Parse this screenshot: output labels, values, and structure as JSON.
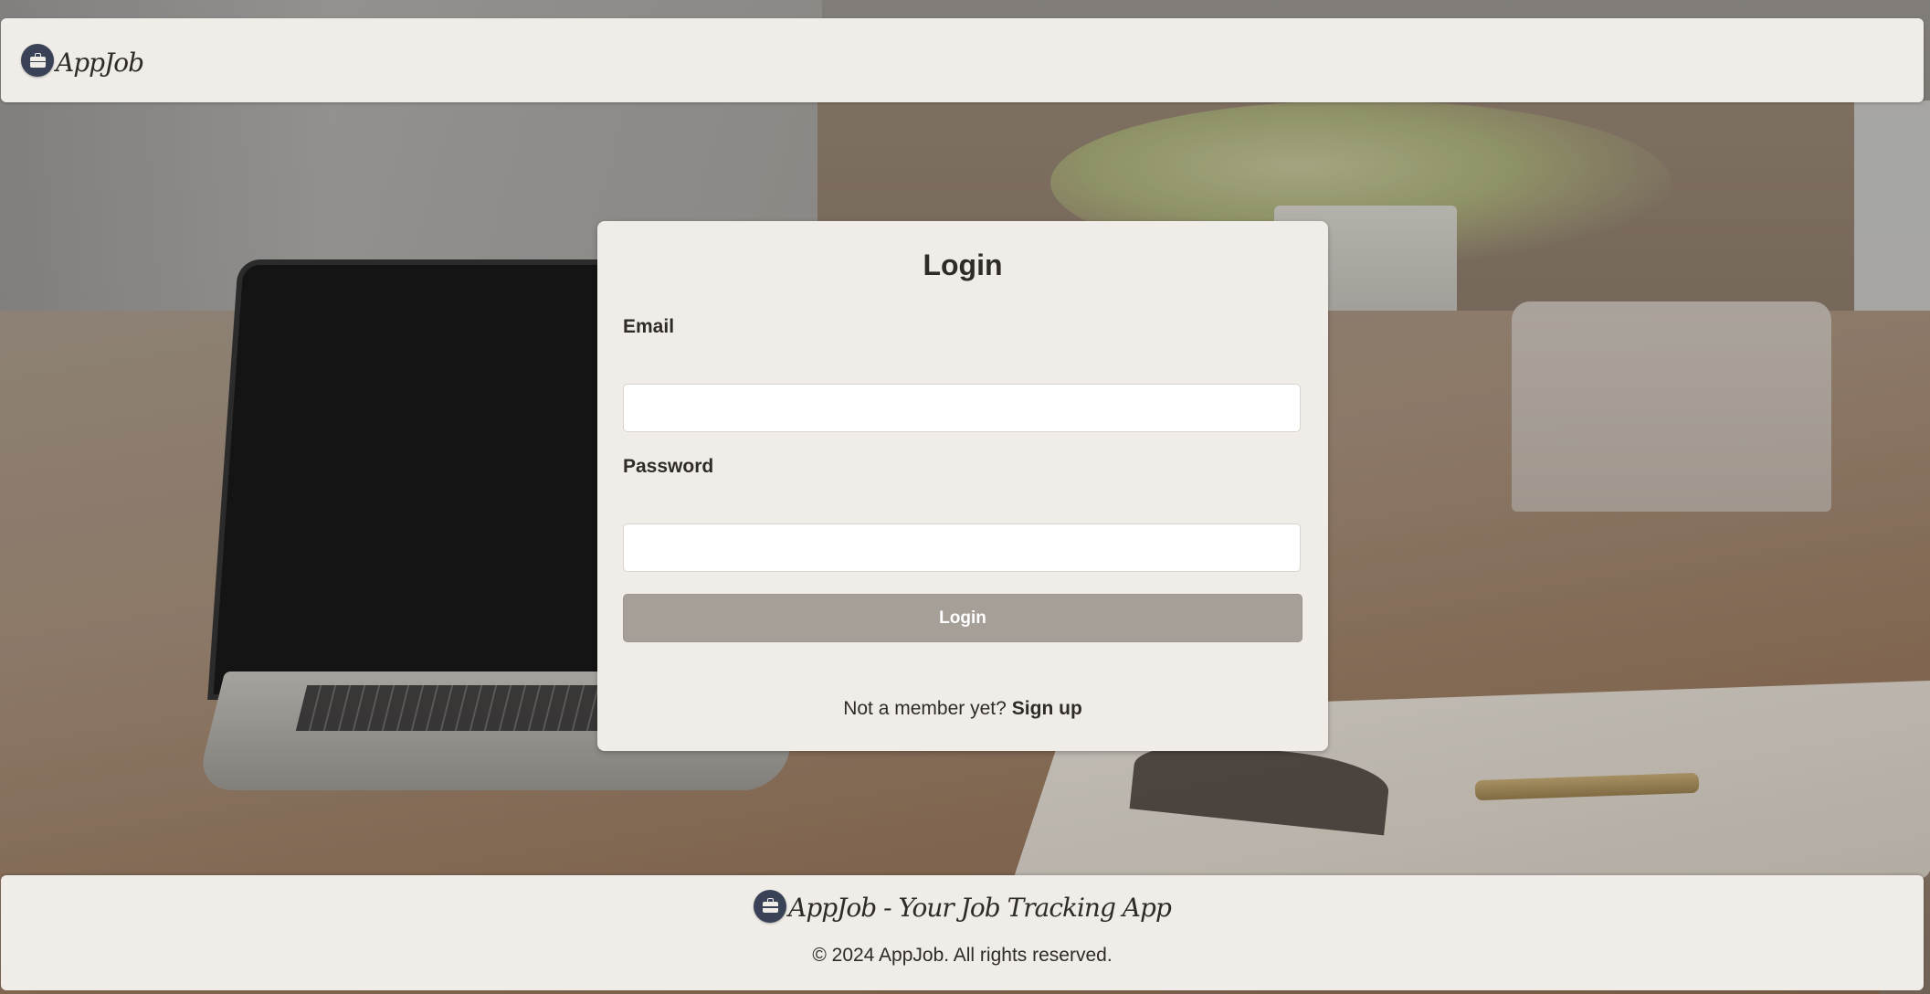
{
  "header": {
    "brand": "AppJob",
    "logo_icon": "briefcase-icon"
  },
  "login": {
    "title": "Login",
    "email_label": "Email",
    "email_value": "",
    "password_label": "Password",
    "password_value": "",
    "submit_label": "Login",
    "signup_prompt": "Not a member yet?",
    "signup_link": "Sign up"
  },
  "footer": {
    "brand": "AppJob - Your Job Tracking App",
    "copyright": "© 2024 AppJob. All rights reserved.",
    "logo_icon": "briefcase-icon"
  },
  "colors": {
    "panel": "#f0ece7",
    "button": "#a69f97",
    "logo": "#3a4258",
    "text": "#2f2b28"
  }
}
